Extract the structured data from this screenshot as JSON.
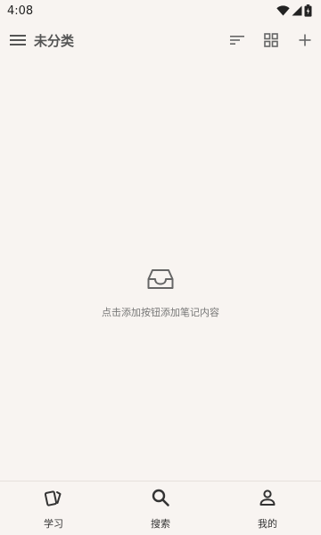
{
  "status_bar": {
    "time": "4:08"
  },
  "app_bar": {
    "title": "未分类",
    "menu_icon": "menu-icon",
    "actions": [
      "sort-icon",
      "grid-view-icon",
      "add-icon"
    ]
  },
  "empty_state": {
    "icon": "inbox-icon",
    "message": "点击添加按钮添加笔记内容"
  },
  "bottom_nav": {
    "items": [
      {
        "label": "学习",
        "icon": "cards-icon"
      },
      {
        "label": "搜索",
        "icon": "search-icon"
      },
      {
        "label": "我的",
        "icon": "person-icon"
      }
    ]
  },
  "colors": {
    "background": "#f8f4f1",
    "text": "#333333",
    "muted": "#777777"
  }
}
